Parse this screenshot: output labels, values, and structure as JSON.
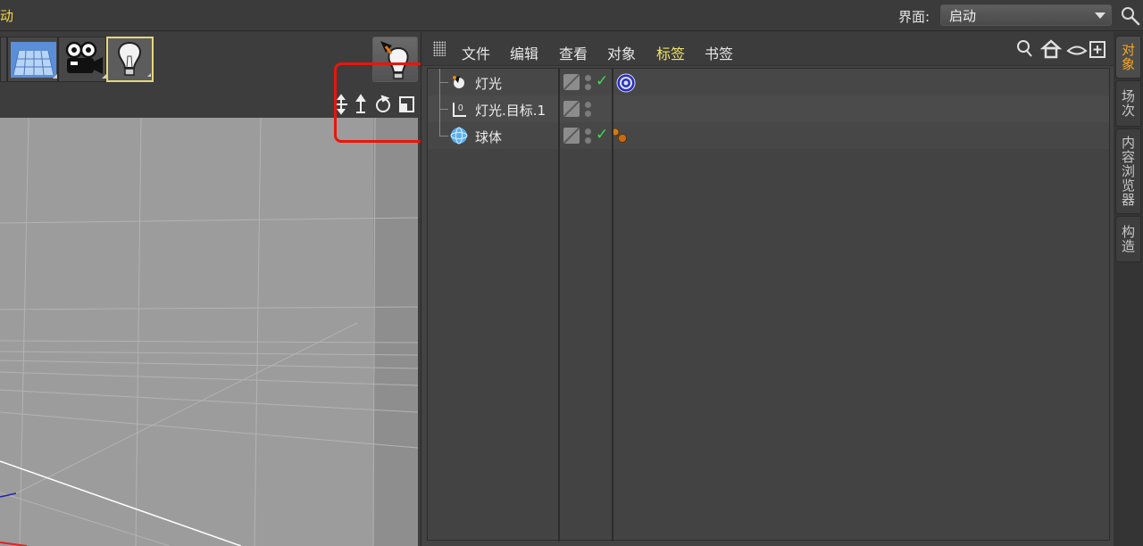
{
  "top_bar": {
    "left_text": "动",
    "layout_label": "界面:",
    "layout_value": "启动"
  },
  "object_manager": {
    "menus": [
      "文件",
      "编辑",
      "查看",
      "对象",
      "标签",
      "书签"
    ],
    "active_menu": "标签",
    "objects": [
      {
        "name": "灯光",
        "icon": "light-icon",
        "tag": "target-tag-icon",
        "visible_check": true
      },
      {
        "name": "灯光.目标.1",
        "icon": "null-object-icon",
        "tag": "",
        "visible_check": false
      },
      {
        "name": "球体",
        "icon": "sphere-icon",
        "tag": "material-tag-icon",
        "visible_check": true
      }
    ]
  },
  "side_tabs": [
    "对象",
    "场次",
    "内容浏览器",
    "构造"
  ],
  "active_side_tab": "对象",
  "colors": {
    "accent": "#f1e36a",
    "active_tab": "#f5a623",
    "highlight": "#e8160c",
    "check": "#3fdc4f"
  }
}
